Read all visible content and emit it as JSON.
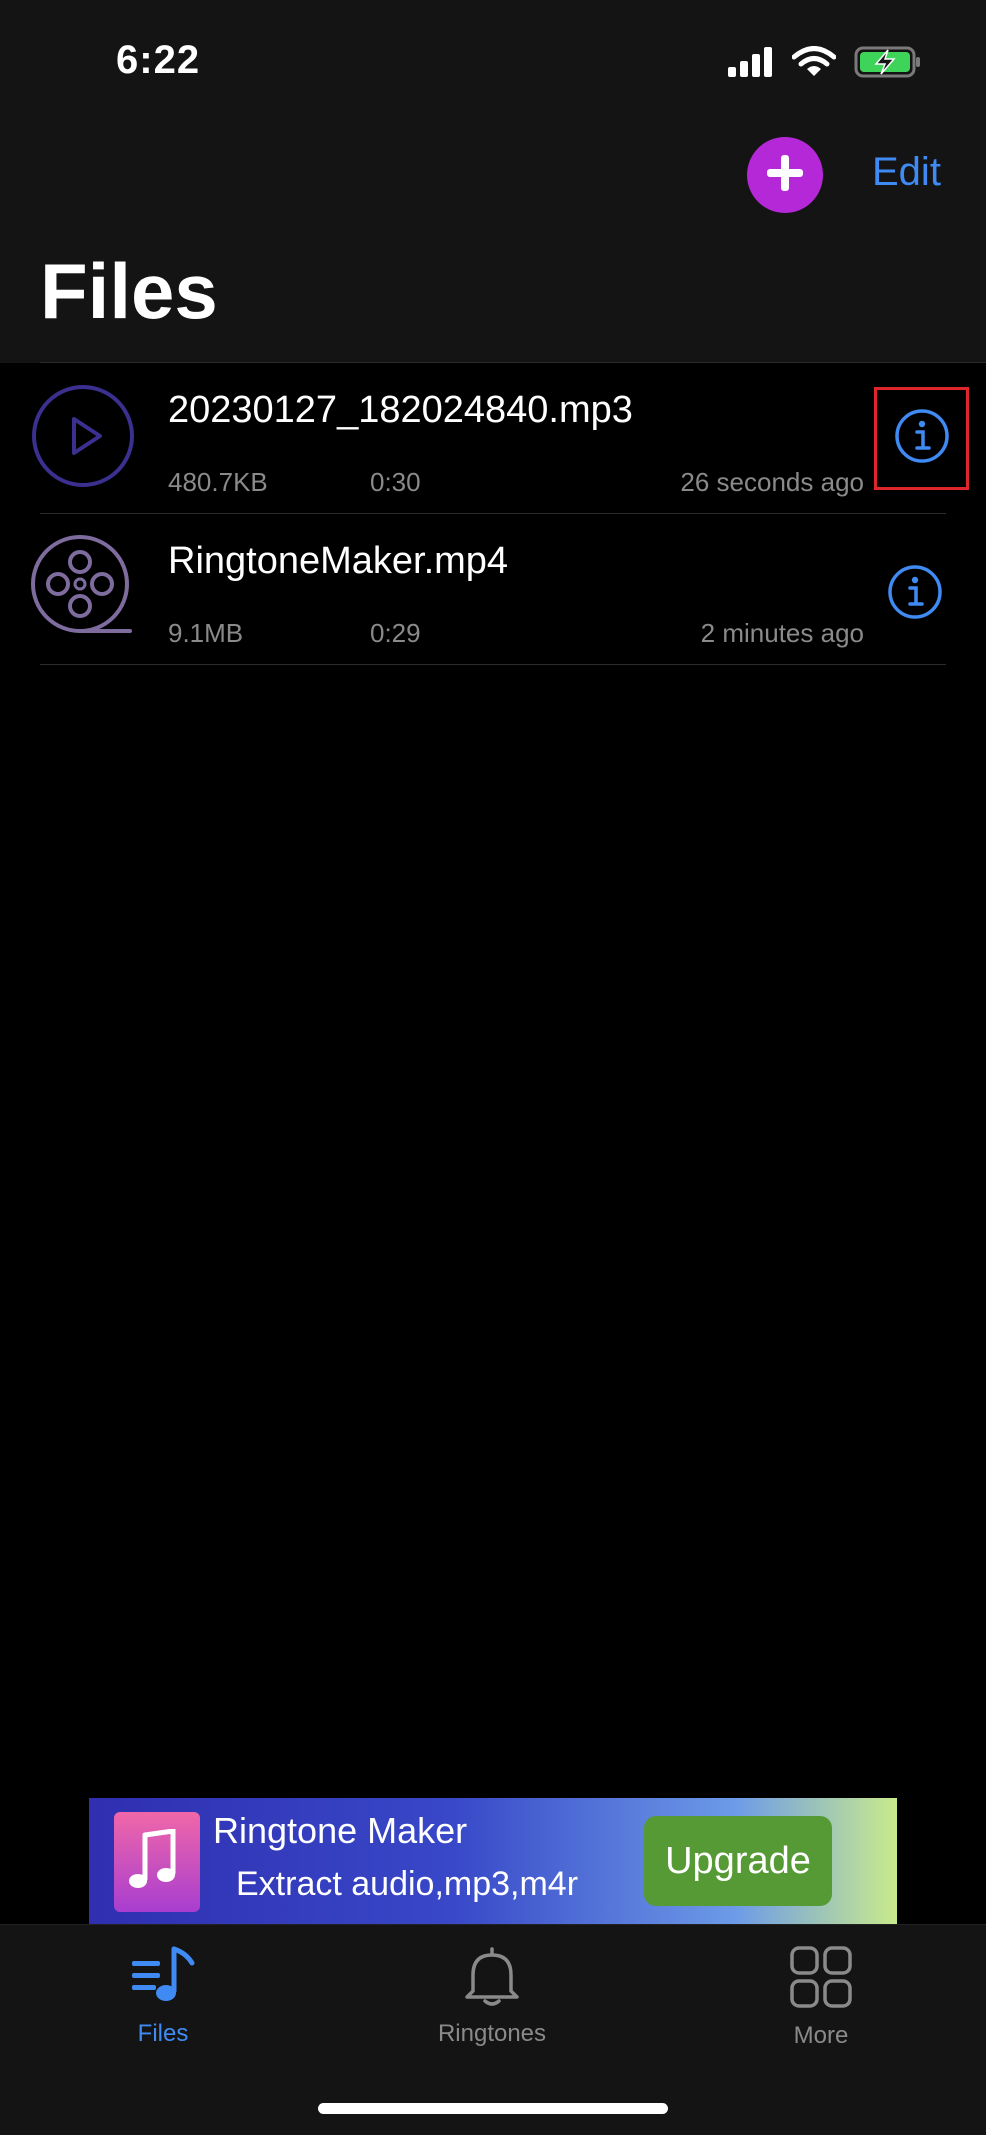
{
  "status_bar": {
    "time": "6:22",
    "icons": [
      "signal-icon",
      "wifi-icon",
      "battery-charging-icon"
    ]
  },
  "nav": {
    "add_icon": "plus-icon",
    "edit_label": "Edit",
    "title": "Files"
  },
  "files": [
    {
      "name": "20230127_182024840.mp3",
      "size": "480.7KB",
      "duration": "0:30",
      "modified": "26 seconds ago",
      "thumb_icon": "play-icon",
      "info_icon": "info-icon",
      "highlighted": true
    },
    {
      "name": "RingtoneMaker.mp4",
      "size": "9.1MB",
      "duration": "0:29",
      "modified": "2 minutes ago",
      "thumb_icon": "film-reel-icon",
      "info_icon": "info-icon",
      "highlighted": false
    }
  ],
  "ad": {
    "title": "Ringtone Maker",
    "subtitle": "Extract audio,mp3,m4r",
    "button_label": "Upgrade",
    "icon": "music-note-icon"
  },
  "tabs": [
    {
      "label": "Files",
      "icon": "music-list-icon",
      "active": true
    },
    {
      "label": "Ringtones",
      "icon": "bell-icon",
      "active": false
    },
    {
      "label": "More",
      "icon": "grid-icon",
      "active": false
    }
  ],
  "colors": {
    "accent": "#3f8bf3",
    "add_button": "#b528d8",
    "highlight_border": "#e0262d",
    "thumb_purple": "#3b2f8f",
    "inactive_tab": "#8a8a8a"
  }
}
